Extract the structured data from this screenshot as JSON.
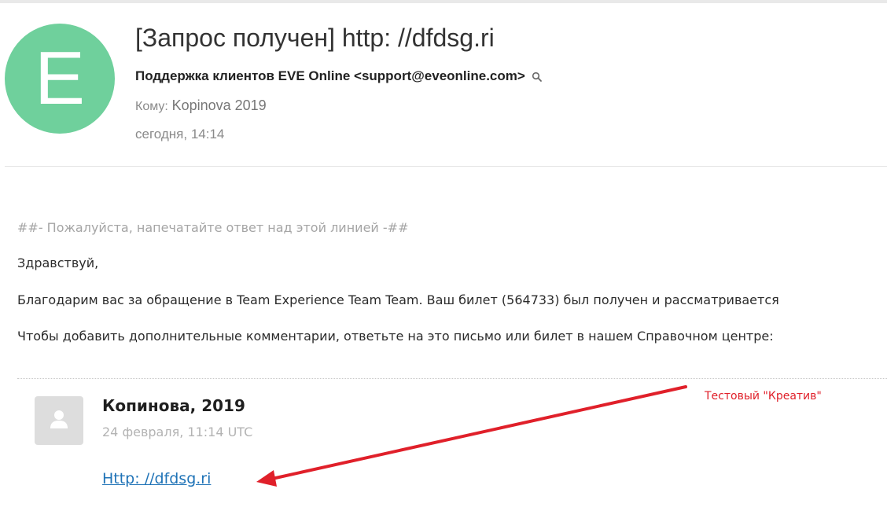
{
  "header": {
    "avatar_letter": "E",
    "avatar_color": "#6fd09c",
    "subject": "[Запрос получен] http: //dfdsg.ri",
    "sender": "Поддержка клиентов EVE Online <support@eveonline.com>",
    "to_label": "Кому:",
    "to_value": "Kopinova 2019",
    "date": "сегодня, 14:14"
  },
  "body": {
    "reply_line": "##- Пожалуйста, напечатайте ответ над этой линией -##",
    "greeting": "Здравствуй,",
    "thanks": "Благодарим вас за обращение в Team Experience Team Team. Ваш билет (564733) был получен и рассматривается",
    "comments": "Чтобы добавить дополнительные комментарии, ответьте на это письмо или билет в нашем Справочном центре:"
  },
  "comment": {
    "author": "Копинова, 2019",
    "date": "24 февраля, 11:14 UTC",
    "link": "Http: //dfdsg.ri",
    "link_color": "#1f73b7"
  },
  "annotation": {
    "label": "Тестовый \"Креатив\"",
    "color": "#e0202a"
  },
  "icons": {
    "sender_lookup": "search-icon",
    "comment_avatar": "user-placeholder-icon"
  }
}
